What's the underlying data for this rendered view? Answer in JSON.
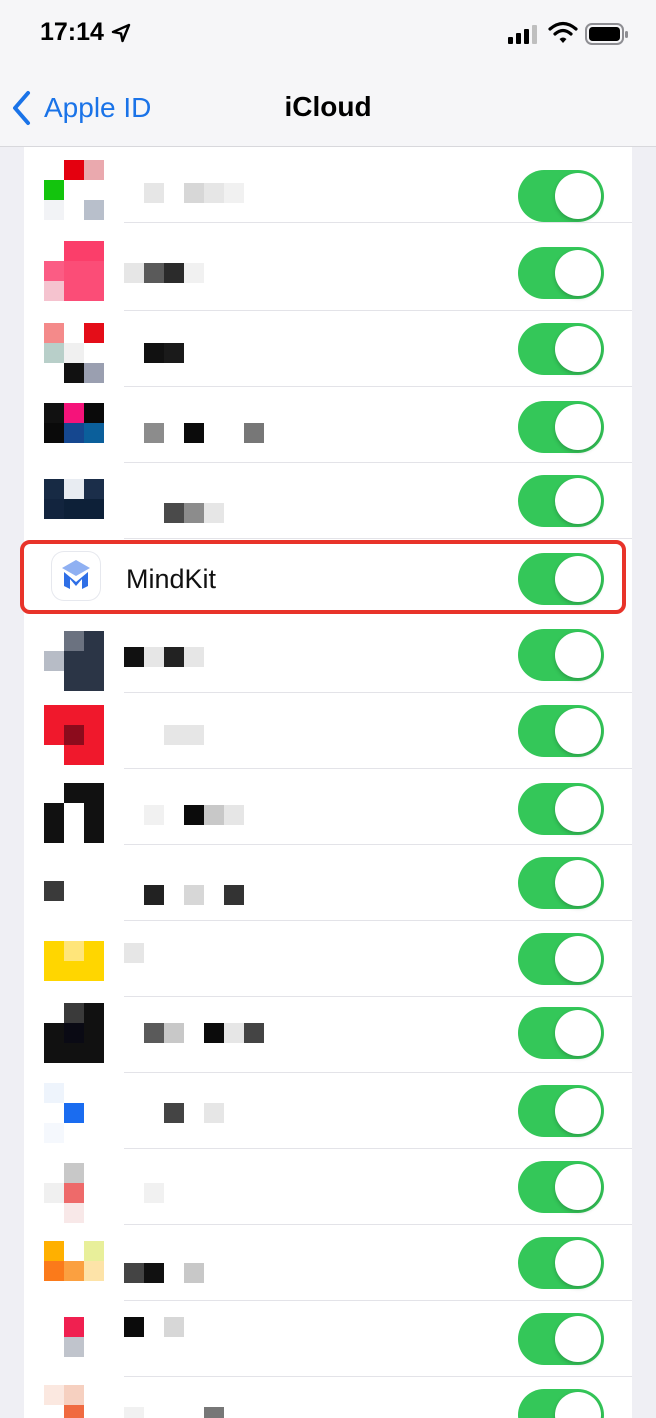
{
  "status_bar": {
    "time": "17:14",
    "icons": [
      "location-arrow-icon",
      "cellular-signal-icon",
      "wifi-icon",
      "battery-icon"
    ]
  },
  "nav": {
    "back_label": "Apple ID",
    "title": "iCloud"
  },
  "colors": {
    "accent_blue": "#1a73e8",
    "toggle_on": "#34c759",
    "highlight": "#e8332a"
  },
  "apps": [
    {
      "label": "",
      "pixelated": true,
      "toggle_on": true
    },
    {
      "label": "",
      "pixelated": true,
      "toggle_on": true
    },
    {
      "label": "",
      "pixelated": true,
      "toggle_on": true
    },
    {
      "label": "",
      "pixelated": true,
      "toggle_on": true
    },
    {
      "label": "",
      "pixelated": true,
      "toggle_on": true
    },
    {
      "label": "MindKit",
      "pixelated": false,
      "toggle_on": true,
      "highlighted": true,
      "icon": "mindkit-app-icon"
    },
    {
      "label": "",
      "pixelated": true,
      "toggle_on": true
    },
    {
      "label": "",
      "pixelated": true,
      "toggle_on": true
    },
    {
      "label": "",
      "pixelated": true,
      "toggle_on": true
    },
    {
      "label": "",
      "pixelated": true,
      "toggle_on": true
    },
    {
      "label": "",
      "pixelated": true,
      "toggle_on": true
    },
    {
      "label": "",
      "pixelated": true,
      "toggle_on": true
    },
    {
      "label": "",
      "pixelated": true,
      "toggle_on": true
    },
    {
      "label": "",
      "pixelated": true,
      "toggle_on": true
    },
    {
      "label": "",
      "pixelated": true,
      "toggle_on": true
    },
    {
      "label": "",
      "pixelated": true,
      "toggle_on": true
    },
    {
      "label": "",
      "pixelated": true,
      "toggle_on": true
    }
  ]
}
